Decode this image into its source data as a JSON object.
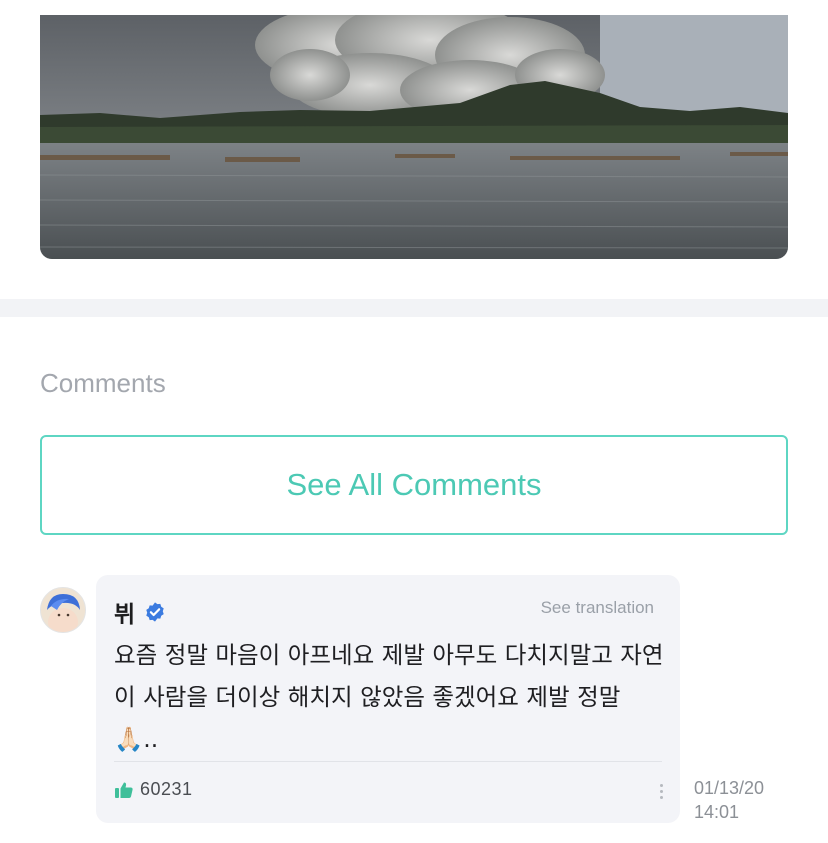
{
  "post_image": {
    "description_icon": "volcano-photo"
  },
  "comments": {
    "heading": "Comments",
    "see_all_label": "See All Comments",
    "items": [
      {
        "author": "뷔",
        "verified": true,
        "see_translation_label": "See translation",
        "text": "요즘 정말 마음이 아프네요 제발 아무도 다치지말고 자연이 사람을 더이상 해치지 않았음 좋겠어요 제발 정말🙏🏻..",
        "likes": "60231",
        "date": "01/13/20",
        "time": "14:01"
      }
    ]
  },
  "colors": {
    "accent": "#4cc9b4",
    "verified": "#3b7be0",
    "like": "#3fbf9a"
  },
  "icons": {
    "verified": "verified-badge-icon",
    "like": "thumbs-up-icon",
    "more": "more-vertical-icon"
  }
}
